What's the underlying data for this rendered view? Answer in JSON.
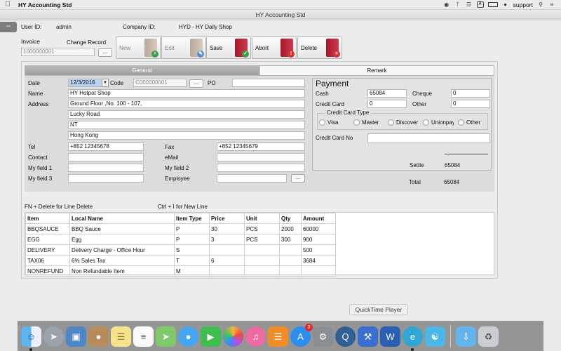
{
  "menubar": {
    "app_name": "HY Accounting Std",
    "right_items": [
      "support"
    ],
    "icons": [
      "q-circle-icon",
      "bluetooth-icon",
      "wifi-icon",
      "input-a-icon",
      "battery-icon",
      "user-icon",
      "spotlight-icon",
      "list-icon"
    ]
  },
  "window": {
    "title": "HY Accounting Std"
  },
  "user": {
    "user_id_label": "User ID:",
    "user_id": "admin",
    "company_id_label": "Company ID:",
    "company_id": "HYD - HY Daily Shop"
  },
  "invoice": {
    "label": "Invoice",
    "change_record_label": "Change Record",
    "placeholder": "1000000001",
    "browse": "..."
  },
  "toolbar": {
    "new_label": "New",
    "edit_label": "Edit",
    "save_label": "Save",
    "abort_label": "Abort",
    "delete_label": "Delete"
  },
  "tabs": {
    "general": "General",
    "remark": "Remark"
  },
  "form": {
    "date_label": "Date",
    "date": "12/3/2016",
    "code_label": "Code",
    "code_placeholder": "C000000001",
    "code_browse": "...",
    "po_label": "PO",
    "po": "",
    "name_label": "Name",
    "name": "HY Hotpot Shop",
    "address_label": "Address",
    "address": [
      "Ground Floor ,No. 100 - 107,",
      "Lucky Road",
      "NT",
      "Hong Kong"
    ],
    "tel_label": "Tel",
    "tel": "+852 12345678",
    "fax_label": "Fax",
    "fax": "+852 12345679",
    "contact_label": "Contact",
    "contact": "",
    "email_label": "eMail",
    "email": "",
    "myfield1_label": "My field 1",
    "myfield1": "",
    "myfield2_label": "My field 2",
    "myfield2": "",
    "myfield3_label": "My field 3",
    "myfield3": "",
    "employee_label": "Employee",
    "employee": "",
    "employee_browse": "..."
  },
  "payment": {
    "title": "Payment",
    "cash_label": "Cash",
    "cash": "65084",
    "cheque_label": "Cheque",
    "cheque": "0",
    "credit_card_label": "Credit Card",
    "credit_card": "0",
    "other_label": "Other",
    "other": "0",
    "cc_type_title": "Credit Card Type",
    "cc_types": [
      "Visa",
      "Master",
      "Discover",
      "Unionpay",
      "Other"
    ],
    "cc_no_label": "Credit Card No",
    "cc_no": "",
    "settle_label": "Settle",
    "settle": "65084",
    "total_label": "Total",
    "total": "65084"
  },
  "hints": {
    "delete_hint": "FN + Delete for Line Delete",
    "newline_hint": "Ctrl + I for New Line"
  },
  "items": {
    "columns": [
      "Item",
      "Local Name",
      "Item Type",
      "Price",
      "Unit",
      "Qty",
      "Amount"
    ],
    "rows": [
      [
        "BBQSAUCE",
        "BBQ Sauce",
        "P",
        "30",
        "PCS",
        "2000",
        "60000"
      ],
      [
        "EGG",
        "Egg",
        "P",
        "3",
        "PCS",
        "300",
        "900"
      ],
      [
        "DELIVERY",
        "Delivery Charge - Office Hour",
        "S",
        "",
        "",
        "",
        "500"
      ],
      [
        "TAX06",
        "6% Sales Tax",
        "T",
        "6",
        "",
        "",
        "3684"
      ],
      [
        "NONREFUND",
        "Non Refundable Item",
        "M",
        "",
        "",
        "",
        ""
      ]
    ]
  },
  "tooltip": {
    "text": "QuickTime Player"
  },
  "dock": {
    "badge_count": "3",
    "apps": [
      "finder-icon",
      "launchpad-icon",
      "preview-icon",
      "contacts-icon",
      "notes-icon",
      "reminders-icon",
      "maps-icon",
      "messages-icon",
      "facetime-icon",
      "photos-icon",
      "itunes-icon",
      "ibooks-icon",
      "app-store-icon",
      "system-preferences-icon",
      "quicktime-icon",
      "xcode-icon",
      "word-icon",
      "hy-e-icon",
      "hy-app-icon",
      "downloads-folder-icon",
      "trash-icon"
    ]
  }
}
